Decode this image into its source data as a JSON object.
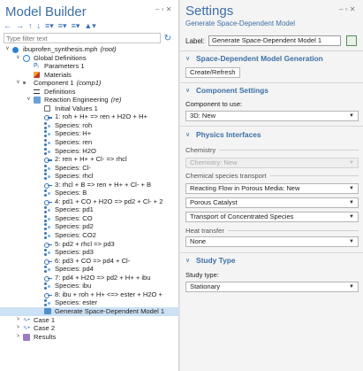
{
  "model_builder": {
    "title": "Model Builder",
    "window_controls": "‒ ▫ ✕",
    "toolbar": [
      "←",
      "→",
      "↑",
      "↓",
      "≡▾",
      "≡▾",
      "≡▾",
      "▲▾"
    ],
    "filter_placeholder": "Type filter text",
    "tree": [
      {
        "depth": 0,
        "twisty": "∨",
        "icon": "file",
        "label": "ibuprofen_synthesis.mph",
        "suffix": "(root)"
      },
      {
        "depth": 1,
        "twisty": "∨",
        "icon": "globe",
        "label": "Global Definitions",
        "suffix": ""
      },
      {
        "depth": 2,
        "twisty": "",
        "icon": "param",
        "label": "Parameters 1",
        "suffix": ""
      },
      {
        "depth": 2,
        "twisty": "",
        "icon": "mat",
        "label": "Materials",
        "suffix": ""
      },
      {
        "depth": 1,
        "twisty": "∨",
        "icon": "comp",
        "label": "Component 1",
        "suffix": "(comp1)"
      },
      {
        "depth": 2,
        "twisty": "",
        "icon": "def",
        "label": "Definitions",
        "suffix": ""
      },
      {
        "depth": 2,
        "twisty": "∨",
        "icon": "re",
        "label": "Reaction Engineering",
        "suffix": "(re)"
      },
      {
        "depth": 3,
        "twisty": "",
        "icon": "init",
        "label": "Initial Values 1",
        "suffix": ""
      },
      {
        "depth": 3,
        "twisty": "",
        "icon": "rx",
        "label": "1: roh + H+ => ren + H2O + H+",
        "suffix": ""
      },
      {
        "depth": 3,
        "twisty": "",
        "icon": "sp",
        "label": "Species: roh",
        "suffix": ""
      },
      {
        "depth": 3,
        "twisty": "",
        "icon": "sp",
        "label": "Species: H+",
        "suffix": ""
      },
      {
        "depth": 3,
        "twisty": "",
        "icon": "sp",
        "label": "Species: ren",
        "suffix": ""
      },
      {
        "depth": 3,
        "twisty": "",
        "icon": "sp",
        "label": "Species: H2O",
        "suffix": ""
      },
      {
        "depth": 3,
        "twisty": "",
        "icon": "rx",
        "label": "2: ren + H+ + Cl- => rhcl",
        "suffix": ""
      },
      {
        "depth": 3,
        "twisty": "",
        "icon": "sp",
        "label": "Species: Cl-",
        "suffix": ""
      },
      {
        "depth": 3,
        "twisty": "",
        "icon": "sp",
        "label": "Species: rhcl",
        "suffix": ""
      },
      {
        "depth": 3,
        "twisty": "",
        "icon": "rx",
        "label": "3: rhcl + B => ren + H+ + Cl- + B",
        "suffix": ""
      },
      {
        "depth": 3,
        "twisty": "",
        "icon": "sp",
        "label": "Species: B",
        "suffix": ""
      },
      {
        "depth": 3,
        "twisty": "",
        "icon": "rx",
        "label": "4: pd1 + CO + H2O => pd2 + Cl- + 2",
        "suffix": ""
      },
      {
        "depth": 3,
        "twisty": "",
        "icon": "sp",
        "label": "Species: pd1",
        "suffix": ""
      },
      {
        "depth": 3,
        "twisty": "",
        "icon": "sp",
        "label": "Species: CO",
        "suffix": ""
      },
      {
        "depth": 3,
        "twisty": "",
        "icon": "sp",
        "label": "Species: pd2",
        "suffix": ""
      },
      {
        "depth": 3,
        "twisty": "",
        "icon": "sp",
        "label": "Species: CO2",
        "suffix": ""
      },
      {
        "depth": 3,
        "twisty": "",
        "icon": "rx",
        "label": "5: pd2 + rhcl => pd3",
        "suffix": ""
      },
      {
        "depth": 3,
        "twisty": "",
        "icon": "sp",
        "label": "Species: pd3",
        "suffix": ""
      },
      {
        "depth": 3,
        "twisty": "",
        "icon": "rx",
        "label": "6: pd3 + CO => pd4 + Cl-",
        "suffix": ""
      },
      {
        "depth": 3,
        "twisty": "",
        "icon": "sp",
        "label": "Species: pd4",
        "suffix": ""
      },
      {
        "depth": 3,
        "twisty": "",
        "icon": "rx",
        "label": "7: pd4 + H2O => pd2 + H+ + ibu",
        "suffix": ""
      },
      {
        "depth": 3,
        "twisty": "",
        "icon": "sp",
        "label": "Species: ibu",
        "suffix": ""
      },
      {
        "depth": 3,
        "twisty": "",
        "icon": "rx",
        "label": "8: ibu + roh + H+ <=> ester + H2O +",
        "suffix": ""
      },
      {
        "depth": 3,
        "twisty": "",
        "icon": "sp",
        "label": "Species: ester",
        "suffix": ""
      },
      {
        "depth": 3,
        "twisty": "",
        "icon": "gen",
        "label": "Generate Space-Dependent Model 1",
        "suffix": "",
        "selected": true
      },
      {
        "depth": 1,
        "twisty": ">",
        "icon": "case",
        "label": "Case 1",
        "suffix": ""
      },
      {
        "depth": 1,
        "twisty": ">",
        "icon": "case",
        "label": "Case 2",
        "suffix": ""
      },
      {
        "depth": 1,
        "twisty": ">",
        "icon": "res",
        "label": "Results",
        "suffix": ""
      }
    ]
  },
  "settings": {
    "title": "Settings",
    "subtitle": "Generate Space-Dependent Model",
    "window_controls": "‒ ▫ ✕",
    "label_caption": "Label:",
    "label_value": "Generate Space-Dependent Model 1",
    "sections": {
      "generation": {
        "title": "Space-Dependent Model Generation",
        "button": "Create/Refresh"
      },
      "component": {
        "title": "Component Settings",
        "caption": "Component to use:",
        "value": "3D: New"
      },
      "physics": {
        "title": "Physics Interfaces",
        "chemistry_group": "Chemistry",
        "chemistry_value": "Chemistry: New",
        "transport_group": "Chemical species transport",
        "transport_values": [
          "Reacting Flow in Porous Media: New",
          "Porous Catalyst",
          "Transport of Concentrated Species"
        ],
        "heat_group": "Heat transfer",
        "heat_value": "None"
      },
      "study": {
        "title": "Study Type",
        "caption": "Study type:",
        "value": "Stationary"
      }
    }
  }
}
